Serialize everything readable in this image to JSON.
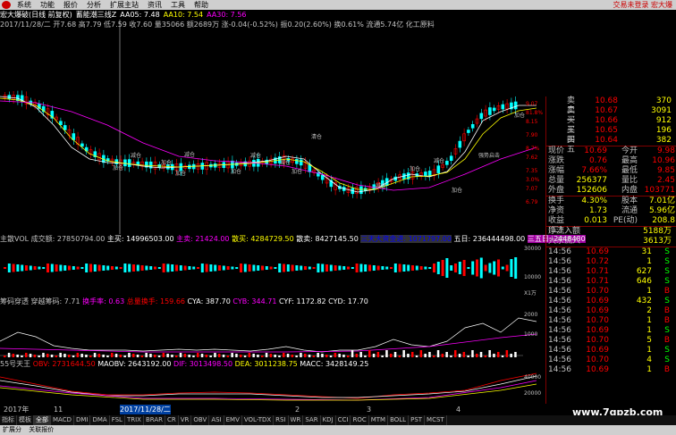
{
  "menubar": {
    "items": [
      "系统",
      "功能",
      "报价",
      "分析",
      "扩展主站",
      "资讯",
      "工具",
      "帮助"
    ],
    "right": "交易未登录 宏大爆"
  },
  "titlebar": {
    "name": "宏大爆破(日线 前复权)",
    "indicator": "蓄能潮三线Z",
    "aa05": "AA05: 7.48",
    "aa10": "AA10: 7.54",
    "aa30": "AA30: 7.56"
  },
  "stockinfo": "2017/11/28/二 开7.68 高7.79 低7.59 收7.60 量35066 额2689万 涨-0.04(-0.52%) 振0.20(2.60%) 换0.61% 流通5.74亿 化工原料",
  "chart_labels": {
    "buy1": "加仓",
    "buy2": "加仓",
    "buy3": "加仓",
    "buy4": "加仓",
    "buy5": "加仓",
    "buy6": "加仓",
    "buy7": "加仓",
    "sell1": "减仓",
    "sell2": "减仓",
    "sell3": "减仓",
    "sell4": "减仓",
    "sell5": "减仓",
    "sell6": "减仓",
    "clear": "清仓",
    "trend": "强势启击",
    "addpos": "加仓",
    "y1": "9.07",
    "y2": "8.15",
    "y3": "7.90",
    "y4": "7.62",
    "y5": "7.35",
    "y6": "7.07",
    "y7": "6.79",
    "p1": "81.8%",
    "p2": "8.7%",
    "p3": "3.0%"
  },
  "volstrip": {
    "a": "主散VOL",
    "b": "成交额: 27850794.00",
    "c": "主买: 14996503.00",
    "d": "主卖: 21424.00",
    "e": "散买: 4284729.50",
    "f": "散卖: 8427145.50",
    "g": "三天大资金进: 1071797.00",
    "h": "五日: 236444498.00",
    "i": "三五日: 2448480",
    "y": "30000",
    "y2": "10000"
  },
  "chipstrip": {
    "a": "筹码穿透",
    "b": "穿越筹码: 7.71",
    "c": "换手率: 0.63",
    "d": "总量换手: 159.66",
    "e": "CYA: 387.70",
    "f": "CYB: 344.71",
    "g": "CYF: 1172.82",
    "h": "CYD: 17.70",
    "y1": "2000",
    "y2": "1000",
    "unit": "X1万"
  },
  "obvstrip": {
    "a": "55号天王",
    "b": "OBV: 2731644.50",
    "c": "MAOBV: 2643192.00",
    "d": "DIF: 3013498.50",
    "e": "DEA: 3011238.75",
    "f": "MACC: 3428149.25",
    "y1": "40000",
    "y2": "20000"
  },
  "datebar": {
    "a": "2017年",
    "b": "11",
    "c": "2017/11/28/二",
    "d": "2",
    "e": "3",
    "f": "4"
  },
  "quotes": [
    {
      "label": "卖二",
      "price": "10.68",
      "vol": "370"
    },
    {
      "label": "卖一",
      "price": "10.67",
      "vol": "3091"
    },
    {
      "label": "买三",
      "price": "10.66",
      "vol": "912"
    },
    {
      "label": "买四",
      "price": "10.65",
      "vol": "196"
    },
    {
      "label": "买五",
      "price": "10.64",
      "vol": "382"
    }
  ],
  "stats": [
    {
      "a": "现价",
      "b": "10.69",
      "c": "今开",
      "d": "9.98"
    },
    {
      "a": "涨跌",
      "b": "0.76",
      "c": "最高",
      "d": "10.96"
    },
    {
      "a": "涨幅",
      "b": "7.66%",
      "c": "最低",
      "d": "9.85"
    },
    {
      "a": "总量",
      "b": "256377",
      "c": "量比",
      "d": "2.45"
    },
    {
      "a": "外盘",
      "b": "152606",
      "c": "内盘",
      "d": "103771"
    }
  ],
  "stats2": [
    {
      "a": "换手",
      "b": "4.30%",
      "c": "股本",
      "d": "7.01亿"
    },
    {
      "a": "净资",
      "b": "1.73",
      "c": "流通",
      "d": "5.96亿"
    },
    {
      "a": "收益(二)",
      "b": "0.013",
      "c": "PE(动)",
      "d": "208.8"
    }
  ],
  "flows": [
    {
      "a": "净流入额",
      "b": "5188万"
    },
    {
      "a": "大宗流入",
      "b": "3613万"
    }
  ],
  "ticks": [
    {
      "t": "14:56",
      "p": "10.69",
      "v": "31",
      "s": "S"
    },
    {
      "t": "14:56",
      "p": "10.72",
      "v": "1",
      "s": "S"
    },
    {
      "t": "14:56",
      "p": "10.71",
      "v": "627",
      "s": "S"
    },
    {
      "t": "14:56",
      "p": "10.71",
      "v": "646",
      "s": "S"
    },
    {
      "t": "14:56",
      "p": "10.70",
      "v": "1",
      "s": "B"
    },
    {
      "t": "14:56",
      "p": "10.69",
      "v": "432",
      "s": "S"
    },
    {
      "t": "14:56",
      "p": "10.69",
      "v": "2",
      "s": "B"
    },
    {
      "t": "14:56",
      "p": "10.70",
      "v": "1",
      "s": "B"
    },
    {
      "t": "14:56",
      "p": "10.69",
      "v": "1",
      "s": "S"
    },
    {
      "t": "14:56",
      "p": "10.70",
      "v": "5",
      "s": "B"
    },
    {
      "t": "14:56",
      "p": "10.69",
      "v": "1",
      "s": "S"
    },
    {
      "t": "14:56",
      "p": "10.70",
      "v": "4",
      "s": "S"
    },
    {
      "t": "14:56",
      "p": "10.69",
      "v": "1",
      "s": "B"
    }
  ],
  "tabs": [
    "指标",
    "模板",
    "全部",
    "MACD",
    "DMI",
    "DMA",
    "FSL",
    "TRIX",
    "BRAR",
    "CR",
    "VR",
    "OBV",
    "ASI",
    "EMV",
    "VOL-TDX",
    "RSI",
    "WR",
    "SAR",
    "KDJ",
    "CCI",
    "ROC",
    "MTM",
    "BOLL",
    "PST",
    "MCST"
  ],
  "status": [
    "扩展分",
    "关联报价"
  ],
  "watermark": "www.7gpzb.com",
  "colors": {
    "up": "#ff0000",
    "down": "#00ffff",
    "ma1": "#ffffff",
    "ma2": "#ffff00",
    "ma3": "#ff00ff"
  }
}
